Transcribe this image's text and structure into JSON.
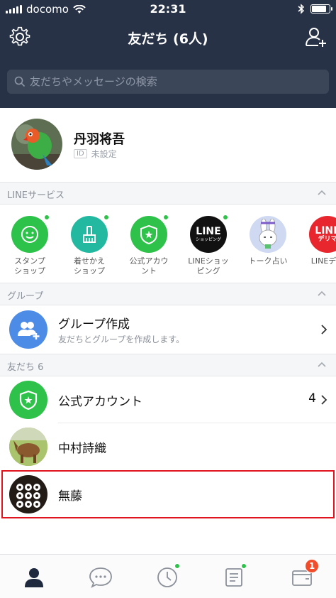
{
  "status_bar": {
    "carrier": "docomo",
    "time": "22:31"
  },
  "header": {
    "title": "友だち (6人)"
  },
  "search": {
    "placeholder": "友だちやメッセージの検索"
  },
  "profile": {
    "name": "丹羽将吾",
    "id_badge": "ID",
    "id_value": "未設定"
  },
  "services_section": {
    "label": "LINEサービス",
    "items": [
      {
        "label": "スタンプ\nショップ",
        "icon": "sticker-shop-icon",
        "color": "#2dc24a",
        "new_dot": true
      },
      {
        "label": "着せかえ\nショップ",
        "icon": "theme-shop-icon",
        "color": "#22b9a0",
        "new_dot": true
      },
      {
        "label": "公式アカウ\nント",
        "icon": "official-account-icon",
        "color": "#2ec24a",
        "new_dot": true
      },
      {
        "label": "LINEショッ\nピング",
        "icon": "line-shopping-icon",
        "color": "#111111",
        "new_dot": true,
        "text": "LINE",
        "subtext": "ショッピング"
      },
      {
        "label": "トーク占い",
        "icon": "fortune-icon",
        "color": "#cfd9f2",
        "new_dot": false
      },
      {
        "label": "LINEデリ",
        "icon": "line-delima-icon",
        "color": "#e8262d",
        "new_dot": false,
        "text": "LINE",
        "subtext": "デリマ"
      }
    ]
  },
  "groups_section": {
    "label": "グループ",
    "create_title": "グループ作成",
    "create_subtitle": "友だちとグループを作成します。"
  },
  "friends_section": {
    "label": "友だち 6",
    "rows": [
      {
        "name": "公式アカウント",
        "count": "4",
        "icon": "official-account-icon"
      },
      {
        "name": "中村詩織",
        "icon": "horse-avatar"
      },
      {
        "name": "無藤",
        "icon": "dots-avatar"
      }
    ]
  },
  "tabbar": {
    "items": [
      "friends-tab",
      "chats-tab",
      "timeline-tab",
      "news-tab",
      "wallet-tab"
    ],
    "wallet_badge": "1"
  },
  "colors": {
    "header_bg": "#273246",
    "line_green": "#2ec24a",
    "highlight": "#e0141e"
  }
}
